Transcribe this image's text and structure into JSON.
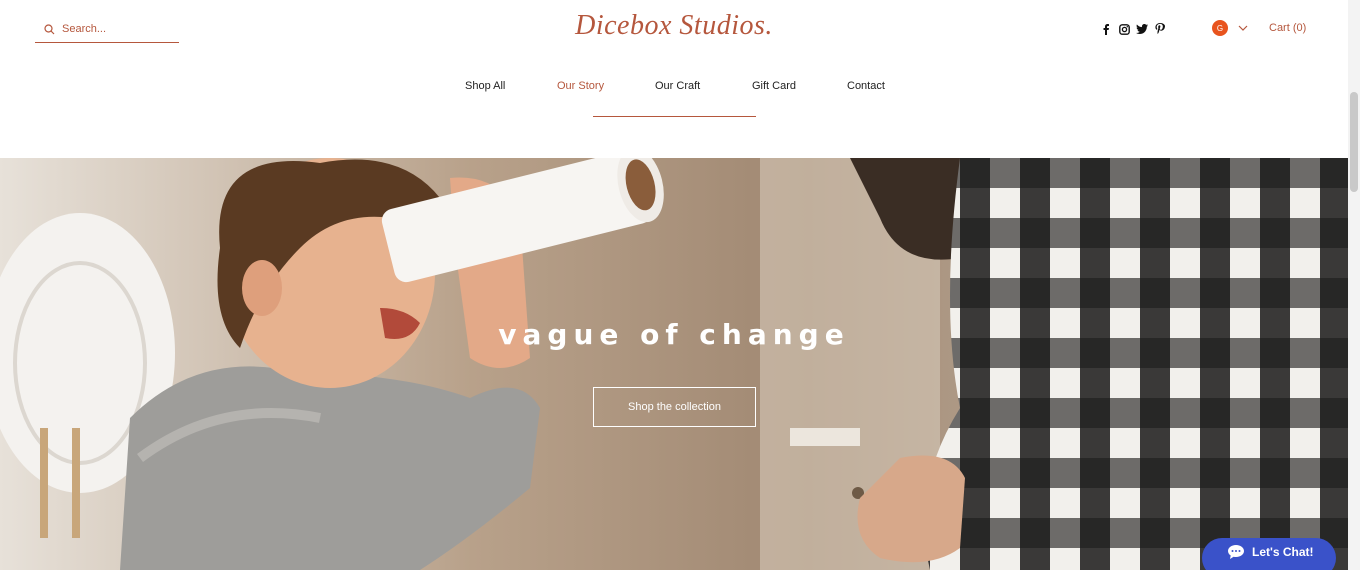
{
  "header": {
    "brand": "Dicebox Studios.",
    "search": {
      "placeholder": "Search..."
    },
    "social": [
      "facebook-icon",
      "instagram-icon",
      "twitter-icon",
      "pinterest-icon"
    ],
    "currency_badge": "G",
    "cart_label": "Cart (0)"
  },
  "nav": {
    "items": [
      {
        "label": "Shop All"
      },
      {
        "label": "Our Story"
      },
      {
        "label": "Our Craft"
      },
      {
        "label": "Gift Card"
      },
      {
        "label": "Contact"
      }
    ],
    "active": "Our Story"
  },
  "hero": {
    "title": "vague of change",
    "button_label": "Shop the collection"
  },
  "chat": {
    "label": "Let's Chat!"
  },
  "colors": {
    "accent": "#b5573d",
    "badge": "#e8541e",
    "chat": "#3a52c9"
  }
}
